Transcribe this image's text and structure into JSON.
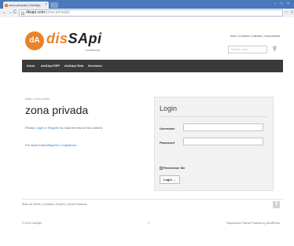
{
  "browser": {
    "tab_title": "zona privada | DisSApi",
    "url_host": "disapi.com",
    "url_path": "/zona-privada/",
    "nav_back": "←",
    "nav_forward": "→",
    "nav_reload": "C",
    "star": "☆",
    "menu": "≡",
    "window_controls": "– □ ×"
  },
  "site": {
    "logo_mark": "dA",
    "logo_brand_a": "dis",
    "logo_brand_b": "SApi",
    "logo_sub": "inmobiliarias",
    "top_links": "Inicio | Contacto | Clientes | zona privada",
    "search_placeholder": "Buscar aquí",
    "search_icon": "⚲",
    "nav": [
      "Inicio",
      "disSApi ERP",
      "disSApi Web",
      "Servicios"
    ]
  },
  "breadcrumb": {
    "home": "Inicio",
    "sep": " / ",
    "current": "zona privada"
  },
  "page": {
    "title": "zona privada",
    "p1_pre": "Please ",
    "p1_login": "Login",
    "p1_or": " or ",
    "p1_register": "Register",
    "p1_post": " to read the rest of this content.",
    "p2_pre": "Por favor ",
    "p2_link": "Autentifíquese o regístrese",
    "p2_post": "."
  },
  "login": {
    "title": "Login",
    "username_label": "Username",
    "password_label": "Password",
    "username_value": "",
    "password_value": "",
    "remember_label": "Remember Me",
    "remember_checked": "✓",
    "button": "Login →"
  },
  "footer": {
    "links": "Base de DiSoft | Contacto | Empleo | Donde Estamos",
    "facebook_icon": "f",
    "copyright": "© 2014 DisSApi",
    "page_number": "1",
    "credits": "Responsive Theme Powered by WordPress"
  }
}
